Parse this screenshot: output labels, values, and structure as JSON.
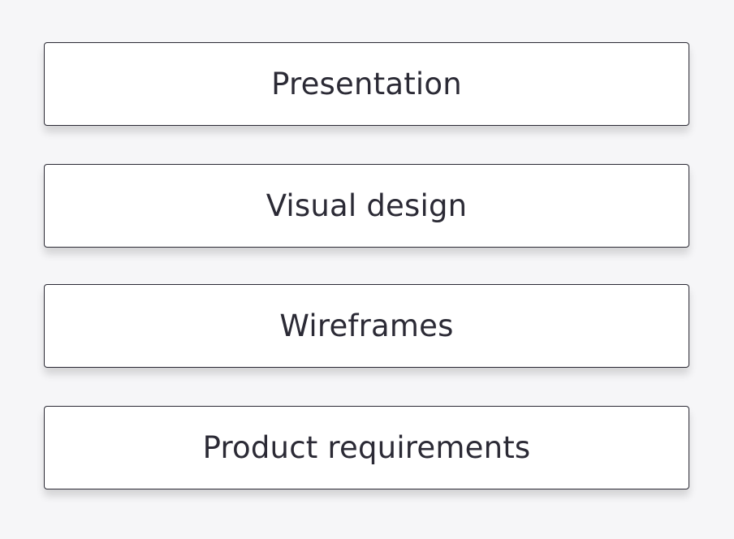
{
  "options": [
    {
      "label": "Presentation"
    },
    {
      "label": "Visual design"
    },
    {
      "label": "Wireframes"
    },
    {
      "label": "Product requirements"
    }
  ],
  "colors": {
    "background": "#f6f6f8",
    "button_background": "#ffffff",
    "button_border": "#2b2a35",
    "text": "#2b2a35"
  }
}
